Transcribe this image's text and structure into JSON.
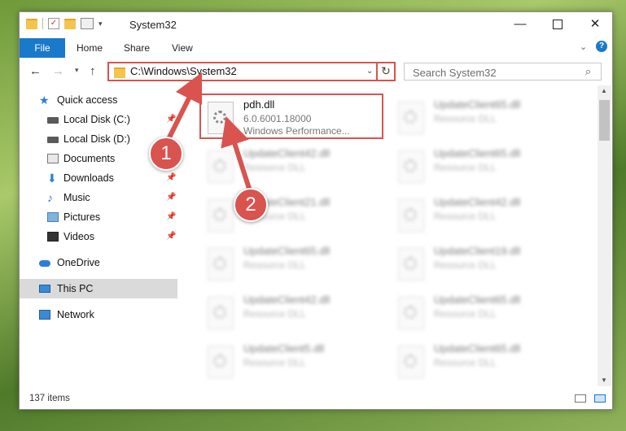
{
  "window": {
    "title": "System32"
  },
  "ribbon": {
    "file": "File",
    "home": "Home",
    "share": "Share",
    "view": "View"
  },
  "address": {
    "path": "C:\\Windows\\System32"
  },
  "search": {
    "placeholder": "Search System32"
  },
  "sidebar": {
    "items": [
      {
        "label": "Quick access",
        "icon": "star-icon"
      },
      {
        "label": "Local Disk (C:)",
        "icon": "drive-icon",
        "pinned": true
      },
      {
        "label": "Local Disk (D:)",
        "icon": "drive-icon"
      },
      {
        "label": "Documents",
        "icon": "documents-icon"
      },
      {
        "label": "Downloads",
        "icon": "download-icon",
        "pinned": true
      },
      {
        "label": "Music",
        "icon": "music-icon",
        "pinned": true
      },
      {
        "label": "Pictures",
        "icon": "pictures-icon",
        "pinned": true
      },
      {
        "label": "Videos",
        "icon": "video-icon",
        "pinned": true
      },
      {
        "label": "OneDrive",
        "icon": "cloud-icon"
      },
      {
        "label": "This PC",
        "icon": "computer-icon",
        "selected": true
      },
      {
        "label": "Network",
        "icon": "network-icon"
      }
    ]
  },
  "files": [
    {
      "name": "pdh.dll",
      "line2": "6.0.6001.18000",
      "line3": "Windows Performance..."
    },
    {
      "name": "UpdateClient65.dll",
      "line2": "Resource DLL"
    },
    {
      "name": "UpdateClient42.dll",
      "line2": "Resource DLL"
    },
    {
      "name": "UpdateClient65.dll",
      "line2": "Resource DLL"
    },
    {
      "name": "UpdateClient21.dll",
      "line2": "Resource DLL"
    },
    {
      "name": "UpdateClient42.dll",
      "line2": "Resource DLL"
    },
    {
      "name": "UpdateClient65.dll",
      "line2": "Resource DLL"
    },
    {
      "name": "UpdateClient19.dll",
      "line2": "Resource DLL"
    },
    {
      "name": "UpdateClient42.dll",
      "line2": "Resource DLL"
    },
    {
      "name": "UpdateClient65.dll",
      "line2": "Resource DLL"
    },
    {
      "name": "UpdateClient5.dll",
      "line2": "Resource DLL"
    },
    {
      "name": "UpdateClient65.dll",
      "line2": "Resource DLL"
    }
  ],
  "status": {
    "count": "137 items"
  },
  "markers": {
    "one": "1",
    "two": "2"
  },
  "colors": {
    "accent": "#1979ca",
    "highlight": "#d9534f"
  }
}
